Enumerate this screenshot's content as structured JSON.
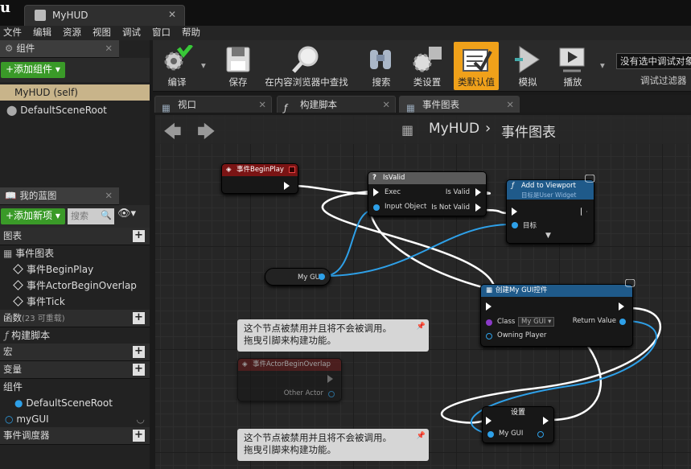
{
  "window": {
    "logo": "u",
    "tab_title": "MyHUD",
    "tab_close": "✕"
  },
  "menu": [
    "文件",
    "编辑",
    "资源",
    "视图",
    "调试",
    "窗口",
    "帮助"
  ],
  "components_panel": {
    "title": "组件",
    "add_button": "+添加组件 ▾",
    "self_item": "MyHUD (self)",
    "root_item": "DefaultSceneRoot"
  },
  "myblueprint_panel": {
    "title": "我的蓝图",
    "add_new_button": "+添加新项 ▾",
    "search_placeholder": "搜索",
    "sections": {
      "graphs": "图表",
      "event_graph": "事件图表",
      "events": [
        "事件BeginPlay",
        "事件ActorBeginOverlap",
        "事件Tick"
      ],
      "functions": "函数",
      "functions_count": "(23 可重载)",
      "construction_script": "构建脚本",
      "macros": "宏",
      "variables": "变量",
      "components": "组件",
      "default_scene_root": "DefaultSceneRoot",
      "mygui_var": "myGUI",
      "event_dispatchers": "事件调度器"
    }
  },
  "toolbar": {
    "compile": "编译",
    "save": "保存",
    "browse": "在内容浏览器中查找",
    "search": "搜索",
    "class_settings": "类设置",
    "class_defaults": "类默认值",
    "simulate": "模拟",
    "play": "播放",
    "debug_dropdown": "没有选中调试对象",
    "debug_filter": "调试过滤器"
  },
  "doc_tabs": [
    "视口",
    "构建脚本",
    "事件图表"
  ],
  "graph": {
    "breadcrumb_root": "MyHUD",
    "breadcrumb_sep": "›",
    "breadcrumb_current": "事件图表"
  },
  "nodes": {
    "beginplay": {
      "title": "事件BeginPlay"
    },
    "isvalid": {
      "title": "IsValid",
      "exec": "Exec",
      "input": "Input Object",
      "is_valid": "Is Valid",
      "is_not_valid": "Is Not Valid"
    },
    "add_to_viewport": {
      "title": "Add to Viewport",
      "subtitle": "目标是User Widget",
      "target": "目标"
    },
    "mygui_get": {
      "label": "My GUI"
    },
    "create_widget": {
      "title": "创建My GUI控件",
      "class": "Class",
      "class_value": "My GUI ▾",
      "owning": "Owning Player",
      "return": "Return Value"
    },
    "overlap": {
      "title": "事件ActorBeginOverlap",
      "other_actor": "Other Actor"
    },
    "set": {
      "title": "设置",
      "var": "My GUI"
    }
  },
  "comments": {
    "c1": "这个节点被禁用并且将不会被调用。\n拖曳引脚来构建功能。",
    "c2": "这个节点被禁用并且将不会被调用。\n拖曳引脚来构建功能。"
  },
  "colors": {
    "accent": "#f0a11a",
    "green": "#3a9a28",
    "event_red": "#8a1a1a",
    "func_blue": "#1f5a8a",
    "pin_blue": "#2ea0e8"
  }
}
